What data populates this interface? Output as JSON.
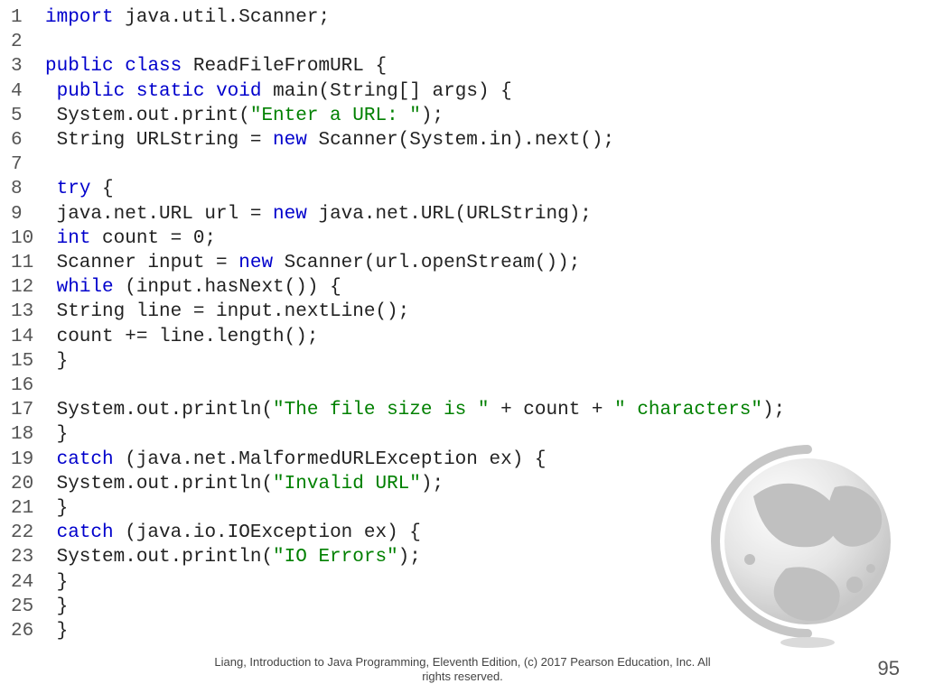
{
  "code": {
    "lines": [
      {
        "n": "1",
        "segs": [
          {
            "c": "kw",
            "t": "import"
          },
          {
            "c": "txt",
            "t": " java.util.Scanner;"
          }
        ]
      },
      {
        "n": "2",
        "segs": []
      },
      {
        "n": "3",
        "segs": [
          {
            "c": "kw",
            "t": "public"
          },
          {
            "c": "txt",
            "t": " "
          },
          {
            "c": "kw",
            "t": "class"
          },
          {
            "c": "txt",
            "t": " ReadFileFromURL {"
          }
        ]
      },
      {
        "n": "4",
        "segs": [
          {
            "c": "txt",
            "t": " "
          },
          {
            "c": "kw",
            "t": "public"
          },
          {
            "c": "txt",
            "t": " "
          },
          {
            "c": "kw",
            "t": "static"
          },
          {
            "c": "txt",
            "t": " "
          },
          {
            "c": "kw",
            "t": "void"
          },
          {
            "c": "txt",
            "t": " main(String[] args) {"
          }
        ]
      },
      {
        "n": "5",
        "segs": [
          {
            "c": "txt",
            "t": " System.out.print("
          },
          {
            "c": "str",
            "t": "\"Enter a URL: \""
          },
          {
            "c": "txt",
            "t": ");"
          }
        ]
      },
      {
        "n": "6",
        "segs": [
          {
            "c": "txt",
            "t": " String URLString = "
          },
          {
            "c": "kw",
            "t": "new"
          },
          {
            "c": "txt",
            "t": " Scanner(System.in).next();"
          }
        ]
      },
      {
        "n": "7",
        "segs": []
      },
      {
        "n": "8",
        "segs": [
          {
            "c": "txt",
            "t": " "
          },
          {
            "c": "kw",
            "t": "try"
          },
          {
            "c": "txt",
            "t": " {"
          }
        ]
      },
      {
        "n": "9",
        "segs": [
          {
            "c": "txt",
            "t": " java.net.URL url = "
          },
          {
            "c": "kw",
            "t": "new"
          },
          {
            "c": "txt",
            "t": " java.net.URL(URLString);"
          }
        ]
      },
      {
        "n": "10",
        "segs": [
          {
            "c": "txt",
            "t": " "
          },
          {
            "c": "kw",
            "t": "int"
          },
          {
            "c": "txt",
            "t": " count = 0;"
          }
        ]
      },
      {
        "n": "11",
        "segs": [
          {
            "c": "txt",
            "t": " Scanner input = "
          },
          {
            "c": "kw",
            "t": "new"
          },
          {
            "c": "txt",
            "t": " Scanner(url.openStream());"
          }
        ]
      },
      {
        "n": "12",
        "segs": [
          {
            "c": "txt",
            "t": " "
          },
          {
            "c": "kw",
            "t": "while"
          },
          {
            "c": "txt",
            "t": " (input.hasNext()) {"
          }
        ]
      },
      {
        "n": "13",
        "segs": [
          {
            "c": "txt",
            "t": " String line = input.nextLine();"
          }
        ]
      },
      {
        "n": "14",
        "segs": [
          {
            "c": "txt",
            "t": " count += line.length();"
          }
        ]
      },
      {
        "n": "15",
        "segs": [
          {
            "c": "txt",
            "t": " }"
          }
        ]
      },
      {
        "n": "16",
        "segs": []
      },
      {
        "n": "17",
        "segs": [
          {
            "c": "txt",
            "t": " System.out.println("
          },
          {
            "c": "str",
            "t": "\"The file size is \""
          },
          {
            "c": "txt",
            "t": " + count + "
          },
          {
            "c": "str",
            "t": "\" characters\""
          },
          {
            "c": "txt",
            "t": ");"
          }
        ]
      },
      {
        "n": "18",
        "segs": [
          {
            "c": "txt",
            "t": " }"
          }
        ]
      },
      {
        "n": "19",
        "segs": [
          {
            "c": "txt",
            "t": " "
          },
          {
            "c": "kw",
            "t": "catch"
          },
          {
            "c": "txt",
            "t": " (java.net.MalformedURLException ex) {"
          }
        ]
      },
      {
        "n": "20",
        "segs": [
          {
            "c": "txt",
            "t": " System.out.println("
          },
          {
            "c": "str",
            "t": "\"Invalid URL\""
          },
          {
            "c": "txt",
            "t": ");"
          }
        ]
      },
      {
        "n": "21",
        "segs": [
          {
            "c": "txt",
            "t": " }"
          }
        ]
      },
      {
        "n": "22",
        "segs": [
          {
            "c": "txt",
            "t": " "
          },
          {
            "c": "kw",
            "t": "catch"
          },
          {
            "c": "txt",
            "t": " (java.io.IOException ex) {"
          }
        ]
      },
      {
        "n": "23",
        "segs": [
          {
            "c": "txt",
            "t": " System.out.println("
          },
          {
            "c": "str",
            "t": "\"IO Errors\""
          },
          {
            "c": "txt",
            "t": ");"
          }
        ]
      },
      {
        "n": "24",
        "segs": [
          {
            "c": "txt",
            "t": " }"
          }
        ]
      },
      {
        "n": "25",
        "segs": [
          {
            "c": "txt",
            "t": " }"
          }
        ]
      },
      {
        "n": "26",
        "segs": [
          {
            "c": "txt",
            "t": " }"
          }
        ]
      }
    ]
  },
  "footer": {
    "line1": "Liang, Introduction to Java Programming, Eleventh Edition, (c) 2017 Pearson Education, Inc. All",
    "line2": "rights reserved."
  },
  "page": "95"
}
